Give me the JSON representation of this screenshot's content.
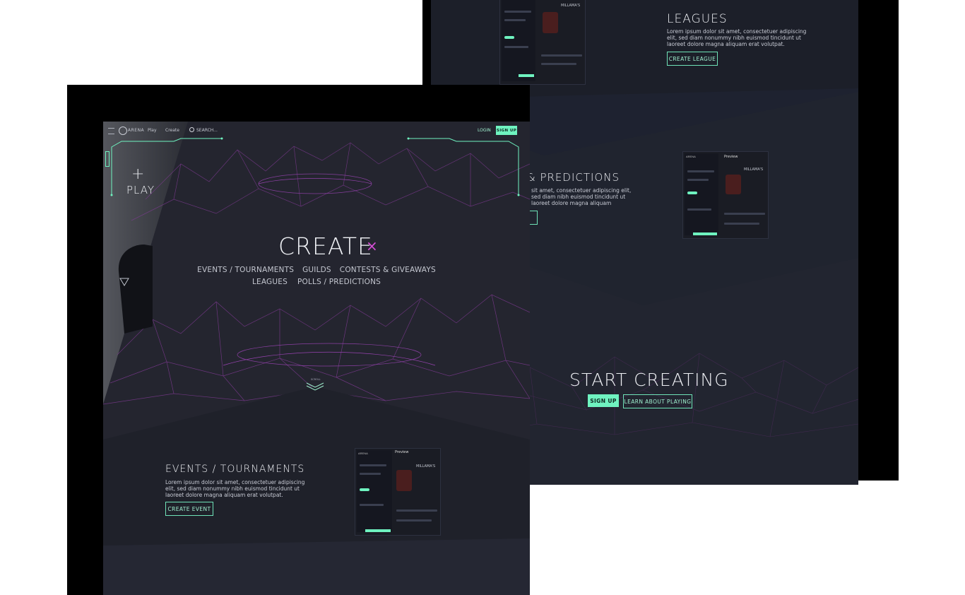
{
  "back": {
    "leagues": {
      "title": "LEAGUES",
      "body": "Lorem ipsum dolor sit amet, consectetuer adipiscing elit, sed diam nonummy nibh euismod tincidunt ut laoreet dolore magna aliquam erat volutpat.",
      "button": "CREATE LEAGUE"
    },
    "polls": {
      "title": "& PREDICTIONS",
      "body": "sit amet, consectetuer adipiscing elit, sed diam nibh euismod tincidunt ut laoreet dolore magna aliquam"
    },
    "preview": {
      "label": "Preview",
      "heading": "MILLAMA'S"
    },
    "cta": {
      "title": "START CREATING",
      "signup": "SIGN UP",
      "learn": "LEARN ABOUT PLAYING"
    }
  },
  "front": {
    "nav": {
      "logo": "ARENA",
      "play": "Play",
      "create": "Create",
      "search_placeholder": "SEARCH...",
      "login": "LOGIN",
      "signup": "SIGN UP"
    },
    "play_panel": {
      "plus": "+",
      "label": "PLAY"
    },
    "hero": {
      "title": "CREATE",
      "close": "×",
      "links_row1": [
        "EVENTS / TOURNAMENTS",
        "GUILDS",
        "CONTESTS & GIVEAWAYS"
      ],
      "links_row2": [
        "LEAGUES",
        "POLLS / PREDICTIONS"
      ],
      "scroll": "SCROLL"
    },
    "events": {
      "title": "EVENTS / TOURNAMENTS",
      "body": "Lorem ipsum dolor sit amet, consectetuer adipiscing elit, sed diam nonummy nibh euismod tincidunt ut laoreet dolore magna aliquam erat volutpat.",
      "button": "CREATE EVENT"
    },
    "preview": {
      "label": "Preview",
      "heading": "MILLAMA'S"
    }
  },
  "colors": {
    "accent": "#6ff3c0",
    "bg_dark": "#1c1f29",
    "bg_page": "#24252f",
    "wire": "#8a3fa3",
    "close_pink": "#d64fd6"
  }
}
